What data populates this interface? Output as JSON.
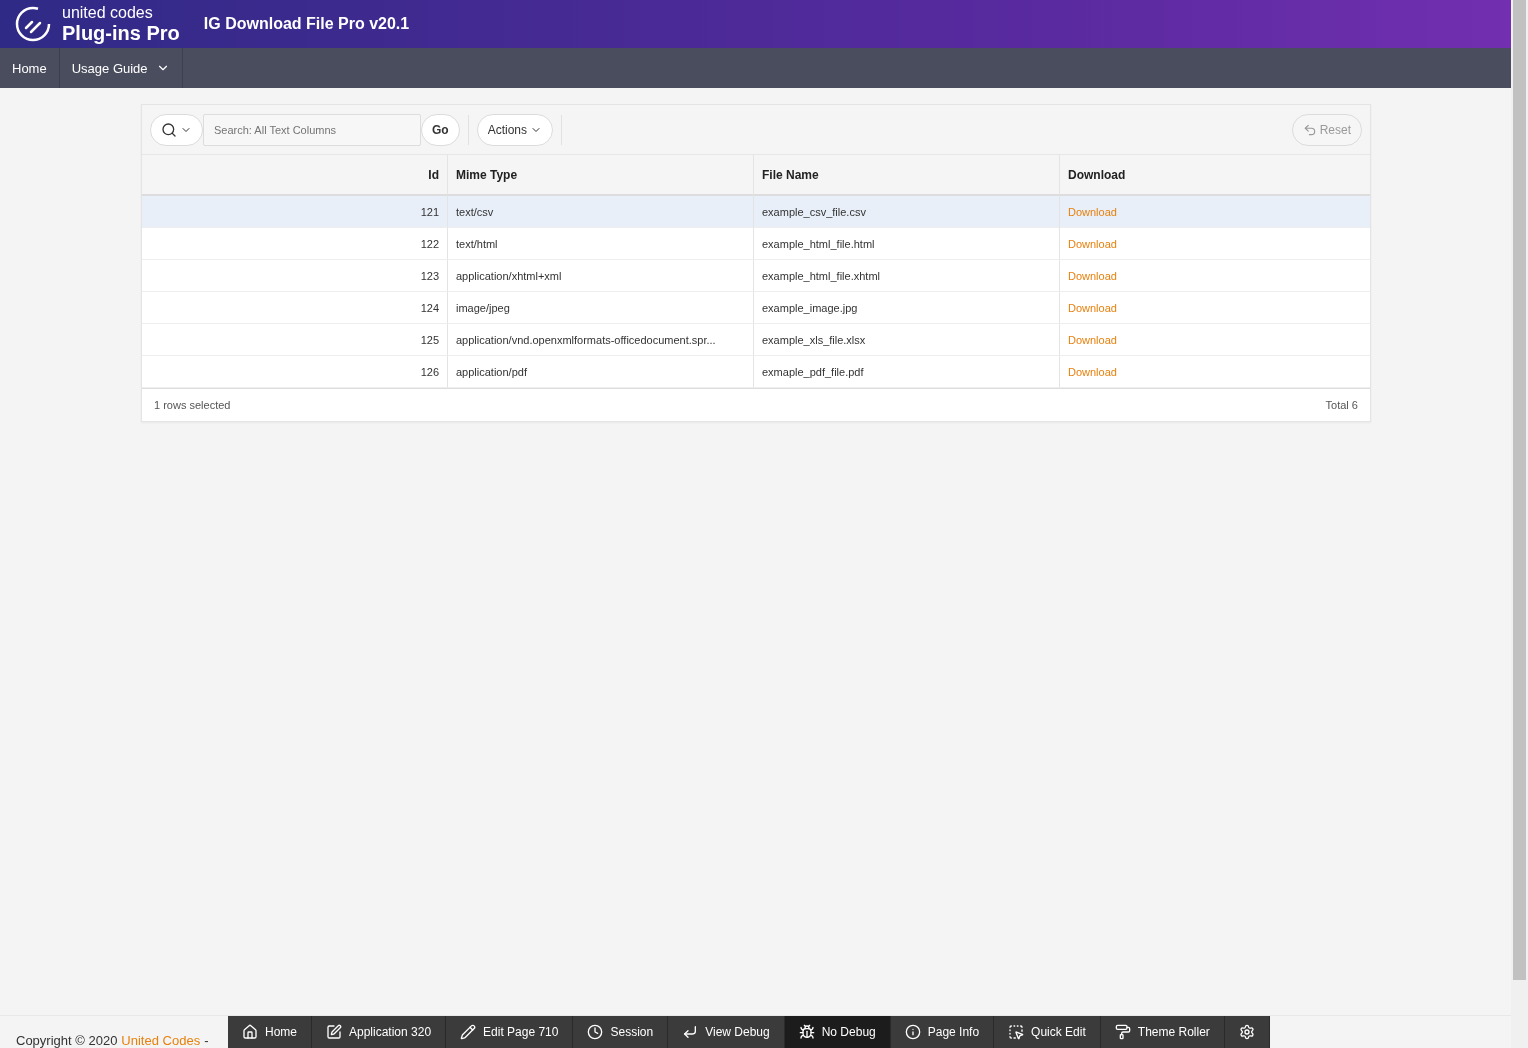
{
  "header": {
    "logo_top": "united codes",
    "logo_bottom": "Plug-ins Pro",
    "title": "IG Download File Pro v20.1"
  },
  "nav": [
    {
      "label": "Home",
      "dropdown": false
    },
    {
      "label": "Usage Guide",
      "dropdown": true
    }
  ],
  "toolbar": {
    "search_placeholder": "Search: All Text Columns",
    "go": "Go",
    "actions": "Actions",
    "reset": "Reset"
  },
  "table": {
    "columns": [
      "Id",
      "Mime Type",
      "File Name",
      "Download"
    ],
    "rows": [
      {
        "id": "121",
        "mime": "text/csv",
        "file": "example_csv_file.csv",
        "link": "Download",
        "selected": true
      },
      {
        "id": "122",
        "mime": "text/html",
        "file": "example_html_file.html",
        "link": "Download",
        "selected": false
      },
      {
        "id": "123",
        "mime": "application/xhtml+xml",
        "file": "example_html_file.xhtml",
        "link": "Download",
        "selected": false
      },
      {
        "id": "124",
        "mime": "image/jpeg",
        "file": "example_image.jpg",
        "link": "Download",
        "selected": false
      },
      {
        "id": "125",
        "mime": "application/vnd.openxmlformats-officedocument.spr...",
        "file": "example_xls_file.xlsx",
        "link": "Download",
        "selected": false
      },
      {
        "id": "126",
        "mime": "application/pdf",
        "file": "exmaple_pdf_file.pdf",
        "link": "Download",
        "selected": false
      }
    ],
    "footer_left": "1 rows selected",
    "footer_right": "Total 6"
  },
  "footer": {
    "text": "Copyright © 2020",
    "link": "United Codes",
    "separator": "-"
  },
  "dev_toolbar": [
    {
      "kind": "home",
      "label": "Home",
      "selected": false
    },
    {
      "kind": "application",
      "label": "Application 320",
      "selected": false
    },
    {
      "kind": "edit",
      "label": "Edit Page 710",
      "selected": false
    },
    {
      "kind": "session",
      "label": "Session",
      "selected": false
    },
    {
      "kind": "debug",
      "label": "View Debug",
      "selected": false
    },
    {
      "kind": "nodebug",
      "label": "No Debug",
      "selected": true
    },
    {
      "kind": "info",
      "label": "Page Info",
      "selected": false
    },
    {
      "kind": "quickedit",
      "label": "Quick Edit",
      "selected": false
    },
    {
      "kind": "theme",
      "label": "Theme Roller",
      "selected": false
    },
    {
      "kind": "settings",
      "selected": false
    }
  ]
}
